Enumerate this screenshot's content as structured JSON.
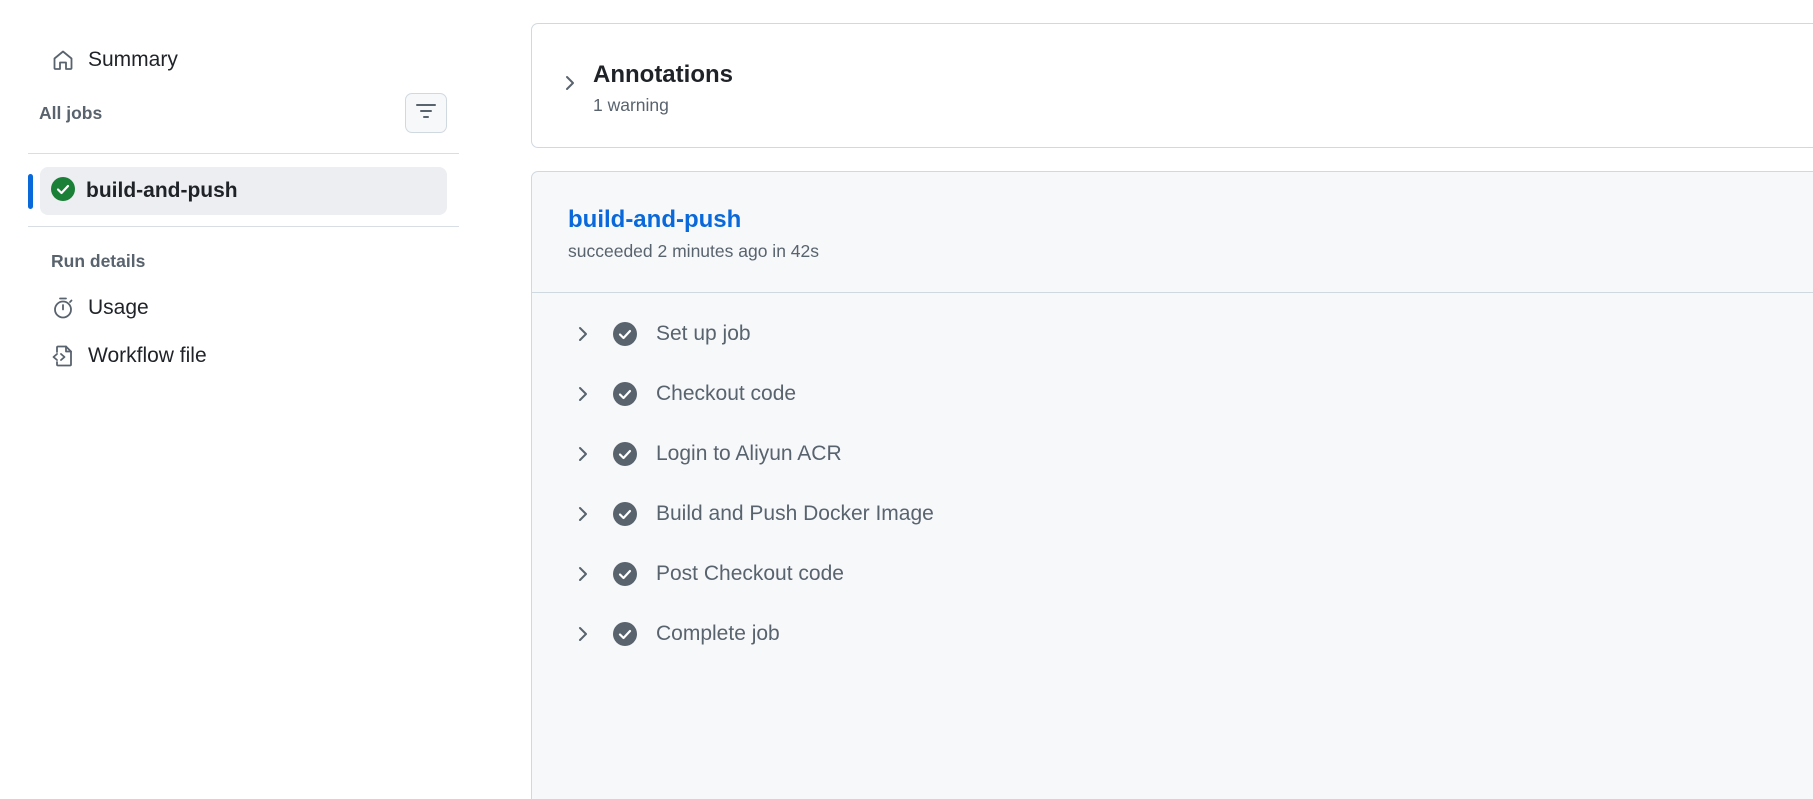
{
  "sidebar": {
    "summary_label": "Summary",
    "all_jobs_heading": "All jobs",
    "jobs": [
      {
        "label": "build-and-push",
        "status": "success"
      }
    ],
    "run_details_heading": "Run details",
    "run_details_items": [
      {
        "label": "Usage",
        "icon": "stopwatch-icon"
      },
      {
        "label": "Workflow file",
        "icon": "file-code-icon"
      }
    ]
  },
  "annotations": {
    "title": "Annotations",
    "summary": "1 warning"
  },
  "job": {
    "title": "build-and-push",
    "subtitle": "succeeded 2 minutes ago in 42s",
    "steps": [
      {
        "label": "Set up job"
      },
      {
        "label": "Checkout code"
      },
      {
        "label": "Login to Aliyun ACR"
      },
      {
        "label": "Build and Push Docker Image"
      },
      {
        "label": "Post Checkout code"
      },
      {
        "label": "Complete job"
      }
    ]
  },
  "colors": {
    "accent": "#0969da",
    "success": "#1a7f37",
    "step_check": "#59636e"
  }
}
